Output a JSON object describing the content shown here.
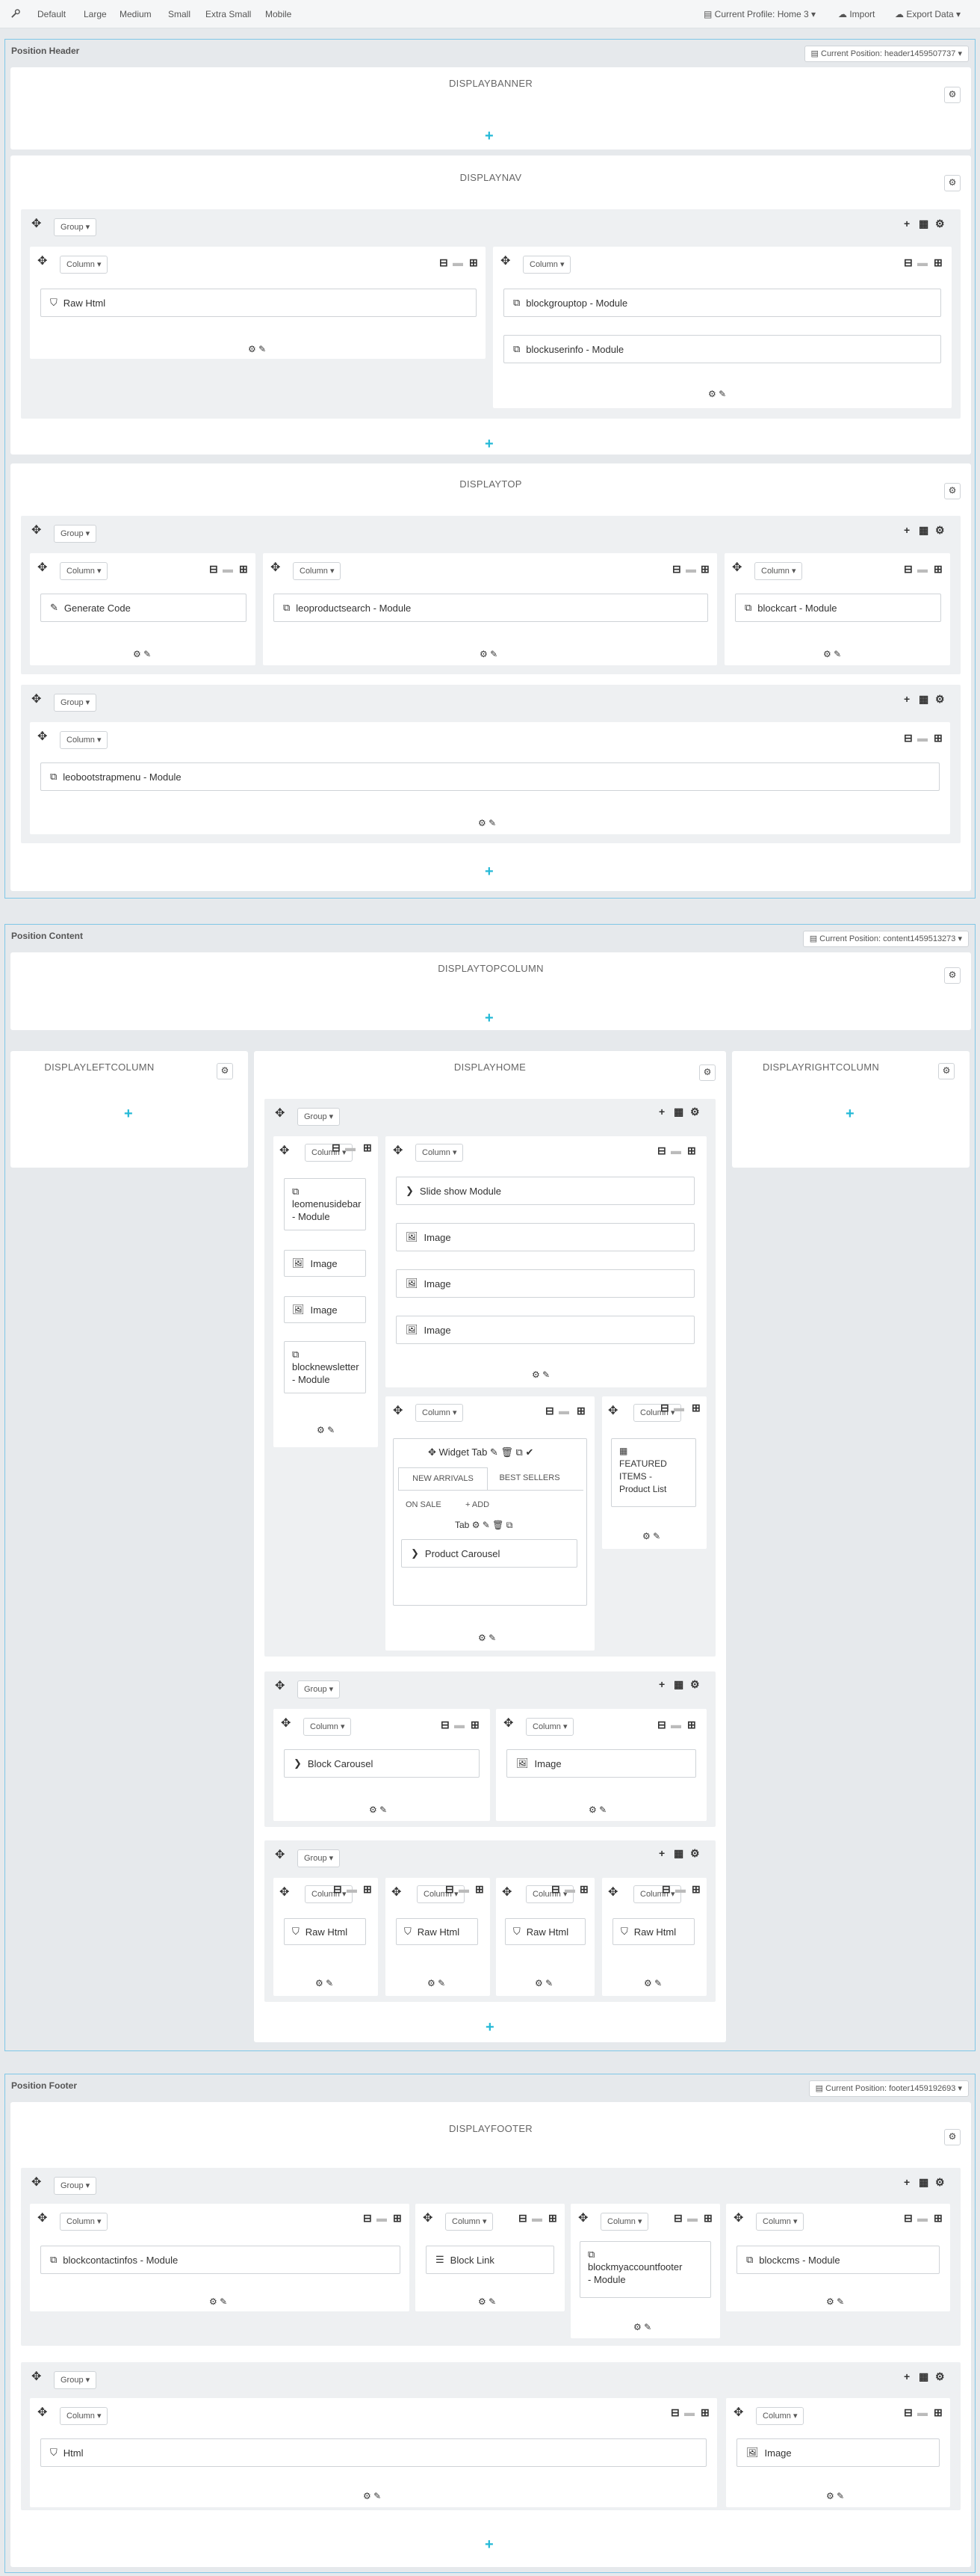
{
  "toolbar": {
    "items": [
      "Default",
      "Large",
      "Medium",
      "Small",
      "Extra Small",
      "Mobile"
    ],
    "profile": "Current Profile: Home 3",
    "import": "Import",
    "export": "Export Data"
  },
  "header": {
    "title": "Position Header",
    "current": "Current Position: header1459507737",
    "displaybanner": "DISPLAYBANNER",
    "displaynav": "DISPLAYNAV",
    "displaytop": "DISPLAYTOP",
    "group_label": "Group",
    "column_label": "Column",
    "nav": {
      "w1": "Raw Html",
      "w2": "blockgrouptop - Module",
      "w3": "blockuserinfo - Module"
    },
    "top": {
      "w1": "Generate Code",
      "w2": "leoproductsearch - Module",
      "w3": "blockcart - Module",
      "w4": "leobootstrapmenu - Module"
    }
  },
  "content": {
    "title": "Position Content",
    "current": "Current Position: content1459513273",
    "topcolumn": "DISPLAYTOPCOLUMN",
    "leftcolumn": "DISPLAYLEFTCOLUMN",
    "home": "DISPLAYHOME",
    "rightcolumn": "DISPLAYRIGHTCOLUMN",
    "g1": {
      "c1": [
        "leomenusidebar",
        "- Module"
      ],
      "img": "Image",
      "c1w3": [
        "blocknewsletter",
        "- Module"
      ],
      "slideshow": "Slide show Module"
    },
    "widgettab": {
      "title": "Widget Tab",
      "tab1": "NEW ARRIVALS",
      "tab2": "BEST SELLERS",
      "tab3": "ON SALE",
      "add": "ADD",
      "tab": "Tab",
      "carousel": "Product Carousel"
    },
    "featured": [
      "FEATURED",
      "ITEMS -",
      "Product List"
    ],
    "g2": {
      "w1": "Block Carousel",
      "w2": "Image"
    },
    "g3": {
      "w": "Raw Html"
    }
  },
  "footer": {
    "title": "Position Footer",
    "current": "Current Position: footer1459192693",
    "displayfooter": "DISPLAYFOOTER",
    "w1": "blockcontactinfos - Module",
    "w2": "Block Link",
    "w3": [
      "blockmyaccountfooter",
      "- Module"
    ],
    "w4": "blockcms - Module",
    "w5": "Html",
    "w6": "Image"
  },
  "colors": {
    "accent": "#25b9d7",
    "border": "#7fc7e7",
    "bg": "#e6e9ec"
  }
}
